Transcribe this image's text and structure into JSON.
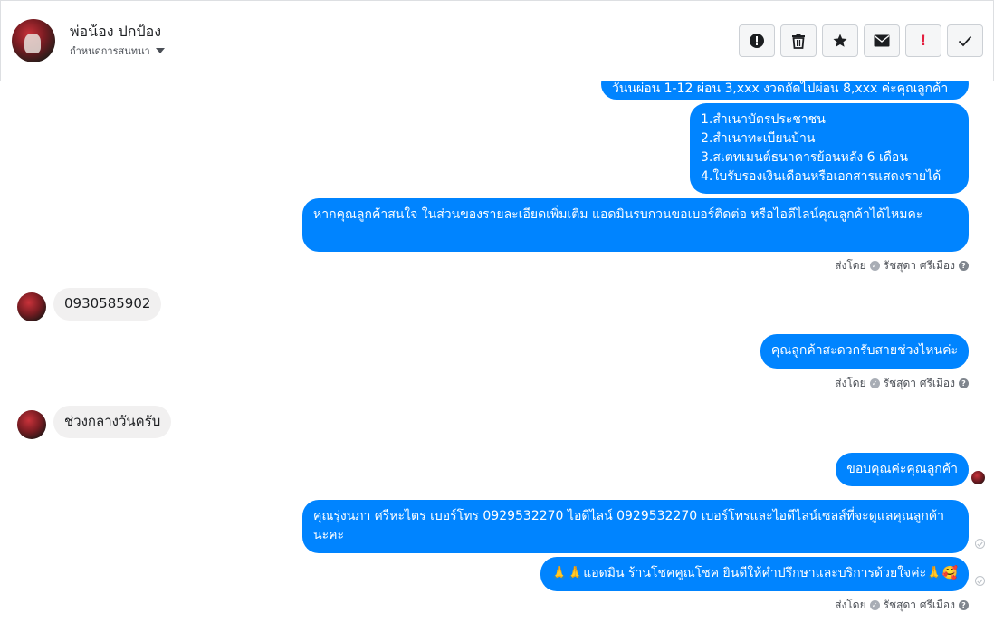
{
  "header": {
    "contact_name": "พ่อน้อง ปกป้อง",
    "setting_label": "กำหนดการสนทนา",
    "toolbar_icons": [
      "alert-icon",
      "trash-icon",
      "star-icon",
      "envelope-icon",
      "exclamation-icon",
      "check-icon"
    ],
    "toolbar_exclaim": "!"
  },
  "messages": {
    "m1": "วันนผ่อน 1-12 ผ่อน 3,xxx งวดถัดไปผ่อน 8,xxx ค่ะคุณลูกค้า",
    "m2": {
      "line1": "1.สำเนาบัตรประชาชน",
      "line2": "2.สำเนาทะเบียนบ้าน",
      "line3": "3.สเตทเมนต์ธนาคารย้อนหลัง 6 เดือน",
      "line4": "4.ใบรับรองเงินเดือนหรือเอกสารแสดงรายได้"
    },
    "m3": "หากคุณลูกค้าสนใจ ในส่วนของรายละเอียดเพิ่มเติม แอดมินรบกวนขอเบอร์ติดต่อ หรือไอดีไลน์คุณลูกค้าได้ไหมคะ",
    "m4": "0930585902",
    "m5": "คุณลูกค้าสะดวกรับสายช่วงไหนค่ะ",
    "m6": "ช่วงกลางวันครับ",
    "m7": "ขอบคุณค่ะคุณลูกค้า",
    "m8": "คุณรุ่งนภา ศรีหะไตร        เบอร์โทร 0929532270  ไอดีไลน์ 0929532270   เบอร์โทรและไอดีไลน์เซลส์ที่จะดูแลคุณลูกค้านะคะ",
    "m9": "🙏🙏แอดมิน ร้านโชคคูณโชค ยินดีให้คำปรึกษาและบริการด้วยใจค่ะ🙏🥰"
  },
  "sent_by": {
    "label": "ส่งโดย",
    "agent": "รัชสุดา ศรีเมือง",
    "help": "?"
  }
}
